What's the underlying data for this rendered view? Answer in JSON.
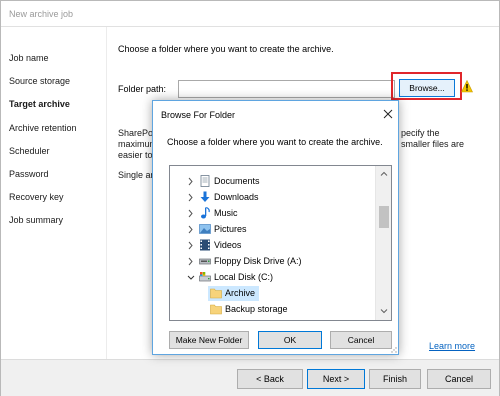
{
  "window": {
    "title": "New archive job"
  },
  "sidebar": {
    "items": [
      {
        "label": "Job name",
        "active": false
      },
      {
        "label": "Source storage",
        "active": false
      },
      {
        "label": "Target archive",
        "active": true
      },
      {
        "label": "Archive retention",
        "active": false
      },
      {
        "label": "Scheduler",
        "active": false
      },
      {
        "label": "Password",
        "active": false
      },
      {
        "label": "Recovery key",
        "active": false
      },
      {
        "label": "Job summary",
        "active": false
      }
    ]
  },
  "main": {
    "prompt": "Choose a folder where you want to create the archive.",
    "folder_path_label": "Folder path:",
    "folder_path_value": "",
    "browse_label": "Browse...",
    "partial_text": {
      "left_line1": "SharePoi",
      "left_line2": "maximum",
      "left_line3": "easier to f",
      "right_line1": "pecify the",
      "right_line2": "smaller files are",
      "single": "Single arc"
    },
    "learn_more": "Learn more"
  },
  "footer": {
    "back": "< Back",
    "next": "Next >",
    "finish": "Finish",
    "cancel": "Cancel"
  },
  "dialog": {
    "title": "Browse For Folder",
    "prompt": "Choose a folder where you want to create the archive.",
    "tree": [
      {
        "label": "Documents",
        "icon": "documents-icon",
        "expander": "collapsed",
        "level": 0,
        "selected": false
      },
      {
        "label": "Downloads",
        "icon": "downloads-icon",
        "expander": "collapsed",
        "level": 0,
        "selected": false
      },
      {
        "label": "Music",
        "icon": "music-icon",
        "expander": "collapsed",
        "level": 0,
        "selected": false
      },
      {
        "label": "Pictures",
        "icon": "pictures-icon",
        "expander": "collapsed",
        "level": 0,
        "selected": false
      },
      {
        "label": "Videos",
        "icon": "videos-icon",
        "expander": "collapsed",
        "level": 0,
        "selected": false
      },
      {
        "label": "Floppy Disk Drive (A:)",
        "icon": "floppy-icon",
        "expander": "collapsed",
        "level": 0,
        "selected": false
      },
      {
        "label": "Local Disk (C:)",
        "icon": "local-disk-icon",
        "expander": "expanded",
        "level": 0,
        "selected": false
      },
      {
        "label": "Archive",
        "icon": "folder-icon",
        "expander": "none",
        "level": 1,
        "selected": true
      },
      {
        "label": "Backup storage",
        "icon": "folder-icon",
        "expander": "none",
        "level": 1,
        "selected": false
      }
    ],
    "make_new_folder": "Make New Folder",
    "ok": "OK",
    "cancel": "Cancel"
  },
  "colors": {
    "highlight_red": "#e0262b",
    "selection_blue": "#cce8ff",
    "link_blue": "#0563c1",
    "folder_yellow": "#f7d37a",
    "warning_yellow": "#f2c500"
  }
}
